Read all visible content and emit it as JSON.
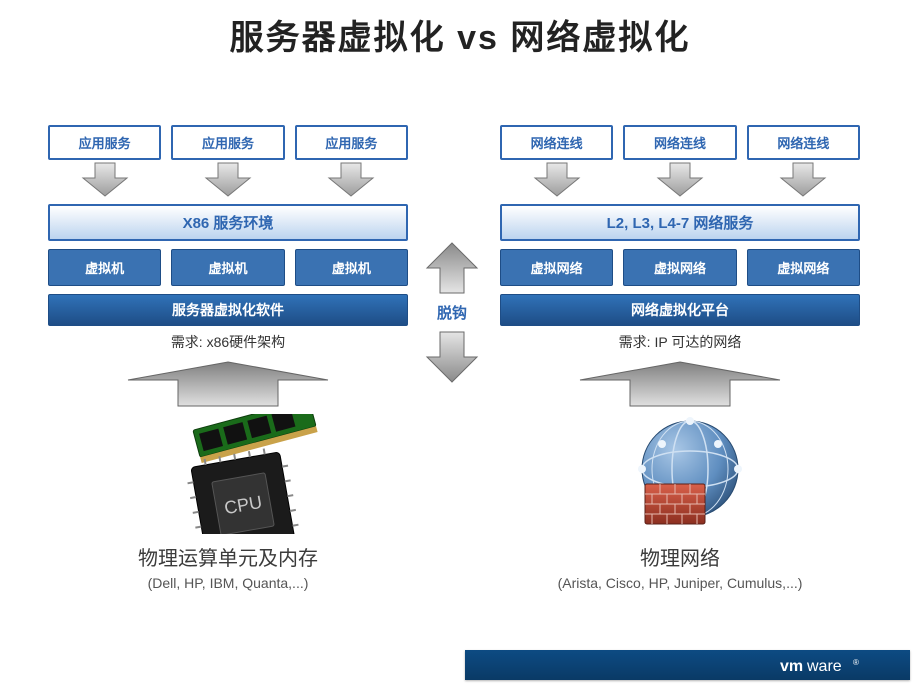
{
  "title": "服务器虚拟化 vs 网络虚拟化",
  "left": {
    "top_boxes": [
      "应用服务",
      "应用服务",
      "应用服务"
    ],
    "env_bar": "X86 服务环境",
    "mid_boxes": [
      "虚拟机",
      "虚拟机",
      "虚拟机"
    ],
    "platform_bar": "服务器虚拟化软件",
    "requirement": "需求: x86硬件架构",
    "bottom_title": "物理运算单元及内存",
    "bottom_sub": "(Dell, HP, IBM, Quanta,...)"
  },
  "right": {
    "top_boxes": [
      "网络连线",
      "网络连线",
      "网络连线"
    ],
    "env_bar": "L2, L3, L4-7 网络服务",
    "mid_boxes": [
      "虚拟网络",
      "虚拟网络",
      "虚拟网络"
    ],
    "platform_bar": "网络虚拟化平台",
    "requirement": "需求: IP 可达的网络",
    "bottom_title": "物理网络",
    "bottom_sub": "(Arista, Cisco, HP, Juniper, Cumulus,...)"
  },
  "center": {
    "label": "脱钩"
  },
  "footer": {
    "brand": "vmware"
  }
}
